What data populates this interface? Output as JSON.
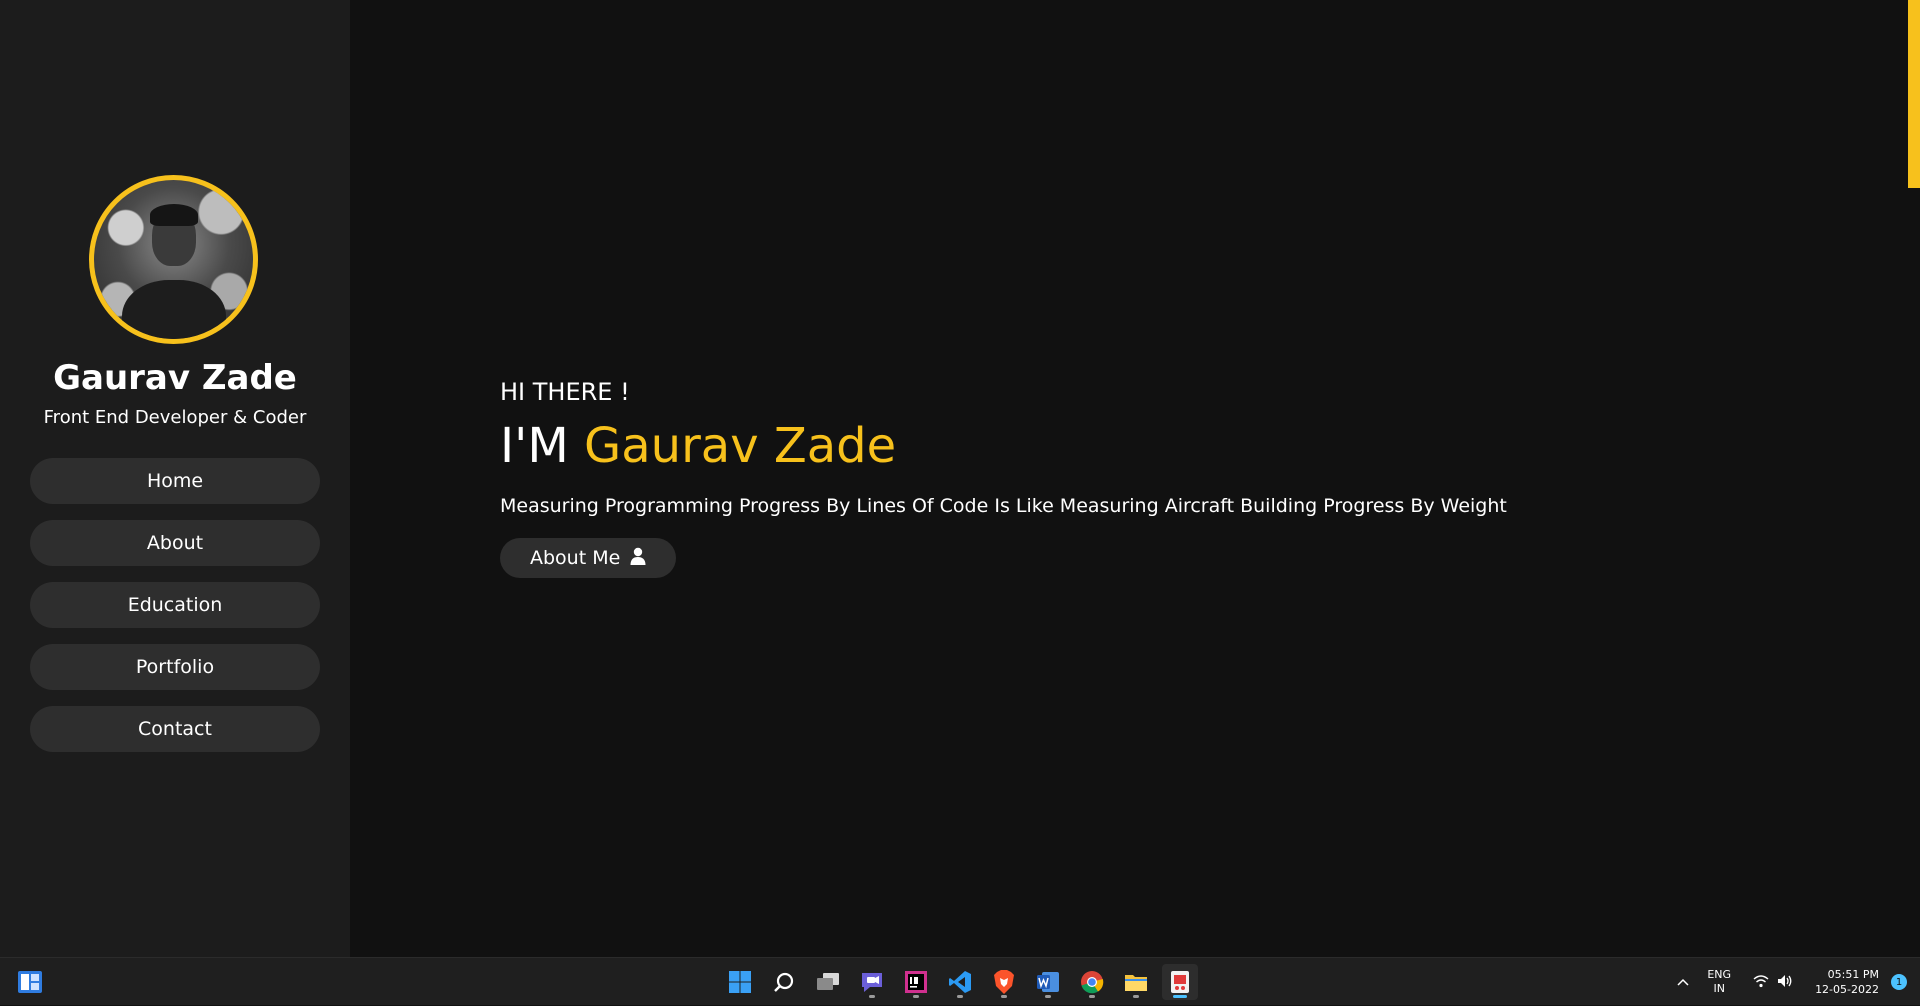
{
  "profile": {
    "name": "Gaurav Zade",
    "role": "Front End Developer & Coder"
  },
  "nav": {
    "items": [
      {
        "label": "Home"
      },
      {
        "label": "About"
      },
      {
        "label": "Education"
      },
      {
        "label": "Portfolio"
      },
      {
        "label": "Contact"
      }
    ]
  },
  "hero": {
    "greeting": "HI THERE !",
    "title_prefix": "I'M",
    "title_name": "Gaurav Zade",
    "quote": "Measuring Programming Progress By Lines Of Code Is Like Measuring Aircraft Building Progress By Weight",
    "cta_label": "About Me",
    "cta_icon": "user-icon"
  },
  "colors": {
    "accent": "#f7c11c",
    "sidebar_bg": "#1c1c1c",
    "main_bg": "#111111",
    "button_bg": "#2e2e2e"
  },
  "taskbar": {
    "apps": [
      "start-icon",
      "search-icon",
      "task-view-icon",
      "teams-chat-icon",
      "intellij-icon",
      "vscode-icon",
      "brave-icon",
      "word-icon",
      "chrome-icon",
      "file-explorer-icon",
      "snipping-tool-icon"
    ],
    "lang_top": "ENG",
    "lang_bottom": "IN",
    "time": "05:51 PM",
    "date": "12-05-2022",
    "notification_count": "1"
  }
}
